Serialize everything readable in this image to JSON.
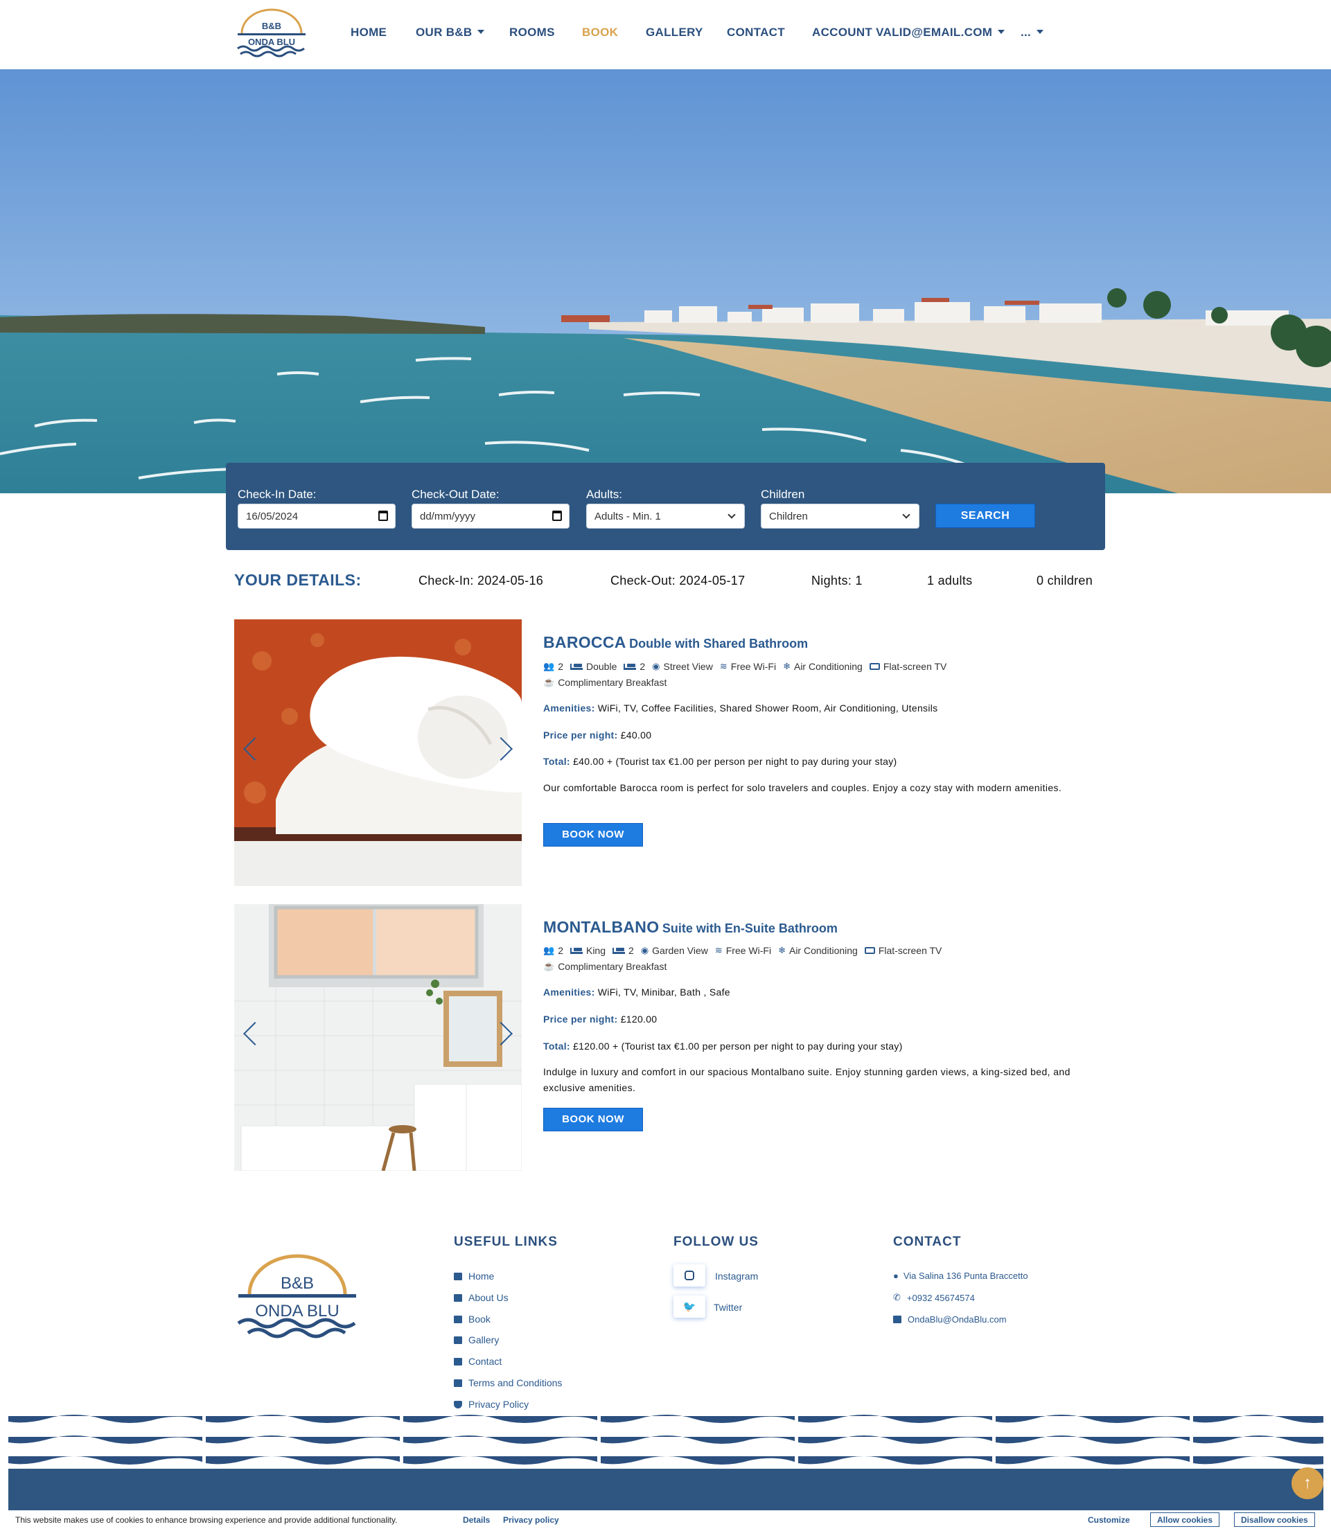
{
  "nav": {
    "items": [
      {
        "label": "HOME",
        "dropdown": false,
        "active": false
      },
      {
        "label": "OUR B&B",
        "dropdown": true,
        "active": false
      },
      {
        "label": "ROOMS",
        "dropdown": false,
        "active": false
      },
      {
        "label": "BOOK",
        "dropdown": false,
        "active": true
      },
      {
        "label": "GALLERY",
        "dropdown": false,
        "active": false
      },
      {
        "label": "CONTACT",
        "dropdown": false,
        "active": false
      },
      {
        "label": "ACCOUNT VALID@EMAIL.COM",
        "dropdown": true,
        "active": false
      },
      {
        "label": "...",
        "dropdown": true,
        "active": false
      }
    ]
  },
  "logo": {
    "line1": "B&B",
    "line2": "ONDA BLU"
  },
  "search": {
    "checkin_label": "Check-In Date:",
    "checkin_value": "16/05/2024",
    "checkout_label": "Check-Out Date:",
    "checkout_value": "dd/mm/yyyy",
    "adults_label": "Adults:",
    "adults_value": "Adults - Min. 1",
    "children_label": "Children",
    "children_value": "Children",
    "button": "SEARCH"
  },
  "details": {
    "title": "YOUR DETAILS:",
    "checkin": "Check-In: 2024-05-16",
    "checkout": "Check-Out: 2024-05-17",
    "nights": "Nights: 1",
    "adults": "1 adults",
    "children": "0 children"
  },
  "rooms": [
    {
      "name": "BAROCCA",
      "subtitle": "Double with Shared Bathroom",
      "guests": "2",
      "bed": "Double",
      "beds_count": "2",
      "view": "Street View",
      "wifi": "Free Wi-Fi",
      "ac": "Air Conditioning",
      "tv": "Flat-screen TV",
      "breakfast": "Complimentary Breakfast",
      "amenities_label": "Amenities:",
      "amenities": "WiFi, TV, Coffee Facilities, Shared Shower Room, Air Conditioning, Utensils",
      "price_label": "Price per night:",
      "price": "£40.00",
      "total_label": "Total:",
      "total": "£40.00 + (Tourist tax €1.00 per person per night to pay during your stay)",
      "description": "Our comfortable Barocca room is perfect for solo travelers and couples. Enjoy a cozy stay with modern amenities.",
      "button": "BOOK NOW"
    },
    {
      "name": "MONTALBANO",
      "subtitle": "Suite with En-Suite Bathroom",
      "guests": "2",
      "bed": "King",
      "beds_count": "2",
      "view": "Garden View",
      "wifi": "Free Wi-Fi",
      "ac": "Air Conditioning",
      "tv": "Flat-screen TV",
      "breakfast": "Complimentary Breakfast",
      "amenities_label": "Amenities:",
      "amenities": "WiFi, TV, Minibar, Bath , Safe",
      "price_label": "Price per night:",
      "price": "£120.00",
      "total_label": "Total:",
      "total": "£120.00 + (Tourist tax €1.00 per person per night to pay during your stay)",
      "description": "Indulge in luxury and comfort in our spacious Montalbano suite. Enjoy stunning garden views, a king-sized bed, and exclusive amenities.",
      "button": "BOOK NOW"
    }
  ],
  "footer": {
    "useful_links_title": "USEFUL LINKS",
    "useful_links": [
      "Home",
      "About Us",
      "Book",
      "Gallery",
      "Contact",
      "Terms and Conditions",
      "Privacy Policy"
    ],
    "follow_title": "FOLLOW US",
    "social": [
      "Instagram",
      "Twitter"
    ],
    "contact_title": "CONTACT",
    "address": "Via Salina 136 Punta Braccetto",
    "phone": "+0932 45674574",
    "email": "OndaBlu@OndaBlu.com"
  },
  "cookie": {
    "text": "This website makes use of cookies to enhance browsing experience and provide additional functionality.",
    "details": "Details",
    "privacy": "Privacy policy",
    "customize": "Customize",
    "allow": "Allow cookies",
    "disallow": "Disallow cookies"
  },
  "colors": {
    "primary": "#2b5a8f",
    "navy": "#2e5680",
    "accent": "#d9a24d",
    "button": "#1e7be0"
  }
}
